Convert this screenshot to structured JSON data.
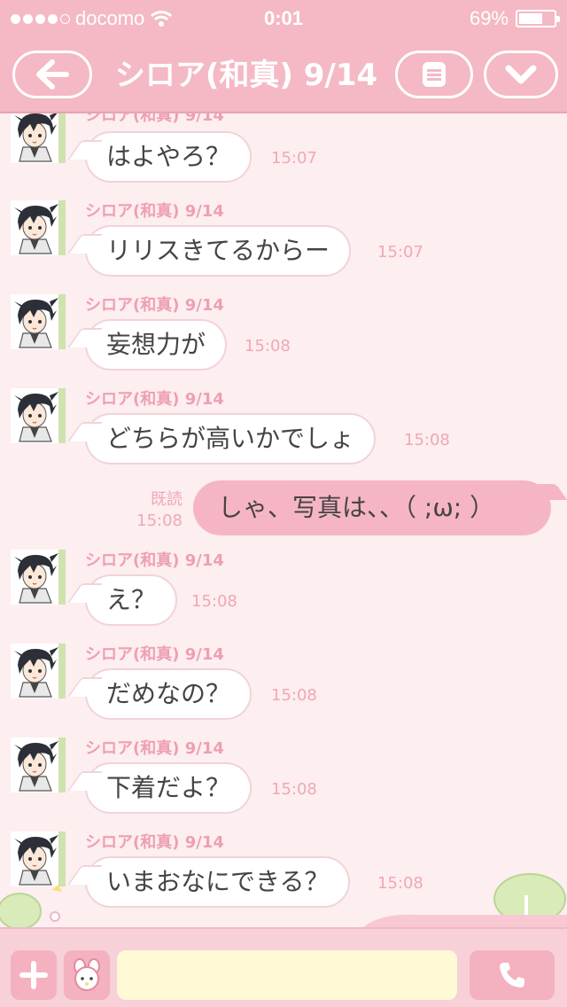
{
  "status_bar": {
    "carrier": "docomo",
    "time": "0:01",
    "battery_percent": "69%",
    "battery_level": 0.69,
    "signal_dots_filled": 4,
    "signal_dots_total": 5
  },
  "header": {
    "title": "シロア(和真) 9/14",
    "back_icon": "arrow-left-icon",
    "menu_icon": "menu-icon",
    "expand_icon": "chevron-down-icon"
  },
  "messages": [
    {
      "sender": "シロア(和真) 9/14",
      "text": "はよやろ？",
      "time": "15:07"
    },
    {
      "sender": "シロア(和真) 9/14",
      "text": "リリスきてるからー",
      "time": "15:07"
    },
    {
      "sender": "シロア(和真) 9/14",
      "text": "妄想力が",
      "time": "15:08"
    },
    {
      "sender": "シロア(和真) 9/14",
      "text": "どちらが高いかでしょ",
      "time": "15:08"
    },
    {
      "sender": "シロア(和真) 9/14",
      "text": "え？",
      "time": "15:08"
    },
    {
      "sender": "シロア(和真) 9/14",
      "text": "だめなの？",
      "time": "15:08"
    },
    {
      "sender": "シロア(和真) 9/14",
      "text": "下着だよ？",
      "time": "15:08"
    },
    {
      "sender": "シロア(和真) 9/14",
      "text": "いまおなにできる？",
      "time": "15:08"
    }
  ],
  "outgoing": {
    "text": "しゃ、写真は、、（ ;ω; ）",
    "read_label": "既読",
    "time": "15:08"
  },
  "input_bar": {
    "placeholder": "",
    "plus_icon": "plus-icon",
    "sticker_icon": "sticker-icon",
    "call_icon": "phone-icon"
  },
  "colors": {
    "header_pink": "#f4b9c4",
    "chat_bg": "#fdeef0",
    "outgoing_bubble": "#f6b5c5",
    "accent_text": "#ee9fb3",
    "input_field": "#fff9d6"
  }
}
